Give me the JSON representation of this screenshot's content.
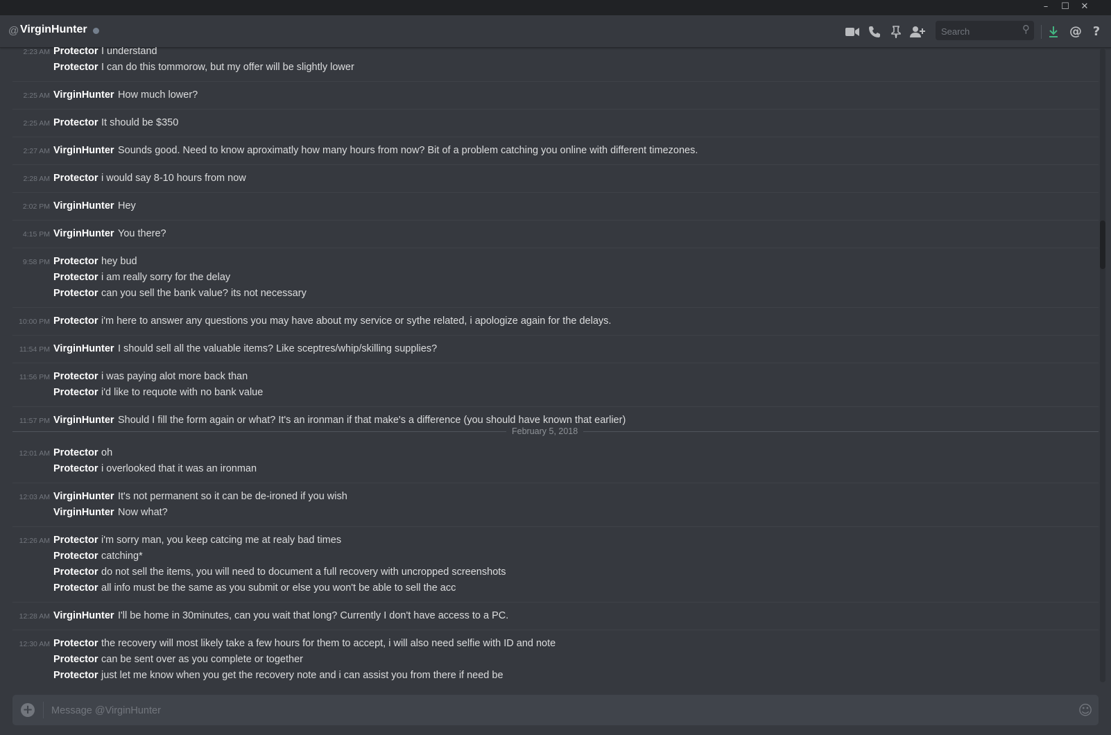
{
  "window": {
    "minimize_glyph": "–",
    "maximize_glyph": "☐",
    "close_glyph": "✕"
  },
  "header": {
    "at_symbol": "@",
    "dm_name": "VirginHunter",
    "status": "offline",
    "icons": {
      "video_call": "video-icon",
      "voice_call": "phone-icon",
      "pinned": "pin-icon",
      "add_friend": "add-user-icon",
      "inbox_download": "download-icon",
      "mentions": "at-icon",
      "help": "help-icon"
    },
    "search_placeholder": "Search"
  },
  "date_divider": "February 5, 2018",
  "groups": [
    {
      "time": "2:23 AM",
      "lines": [
        {
          "author": "Protector",
          "text": "I understand"
        },
        {
          "author": "Protector",
          "text": "I can do this tommorow, but my offer will be slightly lower"
        }
      ]
    },
    {
      "time": "2:25 AM",
      "lines": [
        {
          "author": "VirginHunter",
          "text": "How much lower?"
        }
      ]
    },
    {
      "time": "2:25 AM",
      "lines": [
        {
          "author": "Protector",
          "text": "It should be $350"
        }
      ]
    },
    {
      "time": "2:27 AM",
      "lines": [
        {
          "author": "VirginHunter",
          "text": "Sounds good. Need to know aproximatly how many hours from now? Bit of a problem catching you online with different timezones."
        }
      ]
    },
    {
      "time": "2:28 AM",
      "lines": [
        {
          "author": "Protector",
          "text": "i would say 8-10 hours from now"
        }
      ]
    },
    {
      "time": "2:02 PM",
      "lines": [
        {
          "author": "VirginHunter",
          "text": "Hey"
        }
      ]
    },
    {
      "time": "4:15 PM",
      "lines": [
        {
          "author": "VirginHunter",
          "text": "You there?"
        }
      ]
    },
    {
      "time": "9:58 PM",
      "lines": [
        {
          "author": "Protector",
          "text": "hey bud"
        },
        {
          "author": "Protector",
          "text": "i am really sorry for the delay"
        },
        {
          "author": "Protector",
          "text": "can you sell the bank value? its not necessary"
        }
      ]
    },
    {
      "time": "10:00 PM",
      "lines": [
        {
          "author": "Protector",
          "text": "i'm here to answer any questions you may have about my service or sythe related, i apologize again for the delays."
        }
      ]
    },
    {
      "time": "11:54 PM",
      "lines": [
        {
          "author": "VirginHunter",
          "text": "I should sell all the valuable items? Like sceptres/whip/skilling supplies?"
        }
      ]
    },
    {
      "time": "11:56 PM",
      "lines": [
        {
          "author": "Protector",
          "text": "i was paying alot more back than"
        },
        {
          "author": "Protector",
          "text": "i'd like to requote with no bank value"
        }
      ]
    },
    {
      "time": "11:57 PM",
      "lines": [
        {
          "author": "VirginHunter",
          "text": "Should I fill the form again or what? It's an ironman if that make's a difference (you should have known that earlier)"
        }
      ]
    },
    {
      "time": "12:01 AM",
      "lines": [
        {
          "author": "Protector",
          "text": "oh"
        },
        {
          "author": "Protector",
          "text": "i overlooked that it was an ironman"
        }
      ]
    },
    {
      "time": "12:03 AM",
      "lines": [
        {
          "author": "VirginHunter",
          "text": "It's not permanent so it can be de-ironed if you wish"
        },
        {
          "author": "VirginHunter",
          "text": "Now what?"
        }
      ]
    },
    {
      "time": "12:26 AM",
      "lines": [
        {
          "author": "Protector",
          "text": "i'm sorry man, you keep catcing me at realy bad times"
        },
        {
          "author": "Protector",
          "text": "catching*"
        },
        {
          "author": "Protector",
          "text": "do not sell the items, you will need to document a full recovery with uncropped screenshots"
        },
        {
          "author": "Protector",
          "text": "all info must be the same as you submit or else you won't be able to sell the acc"
        }
      ]
    },
    {
      "time": "12:28 AM",
      "lines": [
        {
          "author": "VirginHunter",
          "text": "I'll be home in 30minutes, can you wait that long? Currently I don't have access to a PC."
        }
      ]
    },
    {
      "time": "12:30 AM",
      "lines": [
        {
          "author": "Protector",
          "text": "the recovery will most likely take a few hours for them to accept, i will also need selfie with ID and note"
        },
        {
          "author": "Protector",
          "text": "can be sent over as you complete or together"
        },
        {
          "author": "Protector",
          "text": "just let me know when you get the recovery note and i can assist you from there if need be"
        }
      ]
    }
  ],
  "composer": {
    "placeholder": "Message @VirginHunter",
    "upload_icon": "plus-circle-icon",
    "emoji_icon": "emoji-icon"
  },
  "colors": {
    "background": "#36393f",
    "titlebar": "#202225",
    "composer": "#40444b",
    "author": "#ffffff",
    "text": "#dcddde",
    "timestamp": "#72767d",
    "download_accent": "#43b581"
  }
}
